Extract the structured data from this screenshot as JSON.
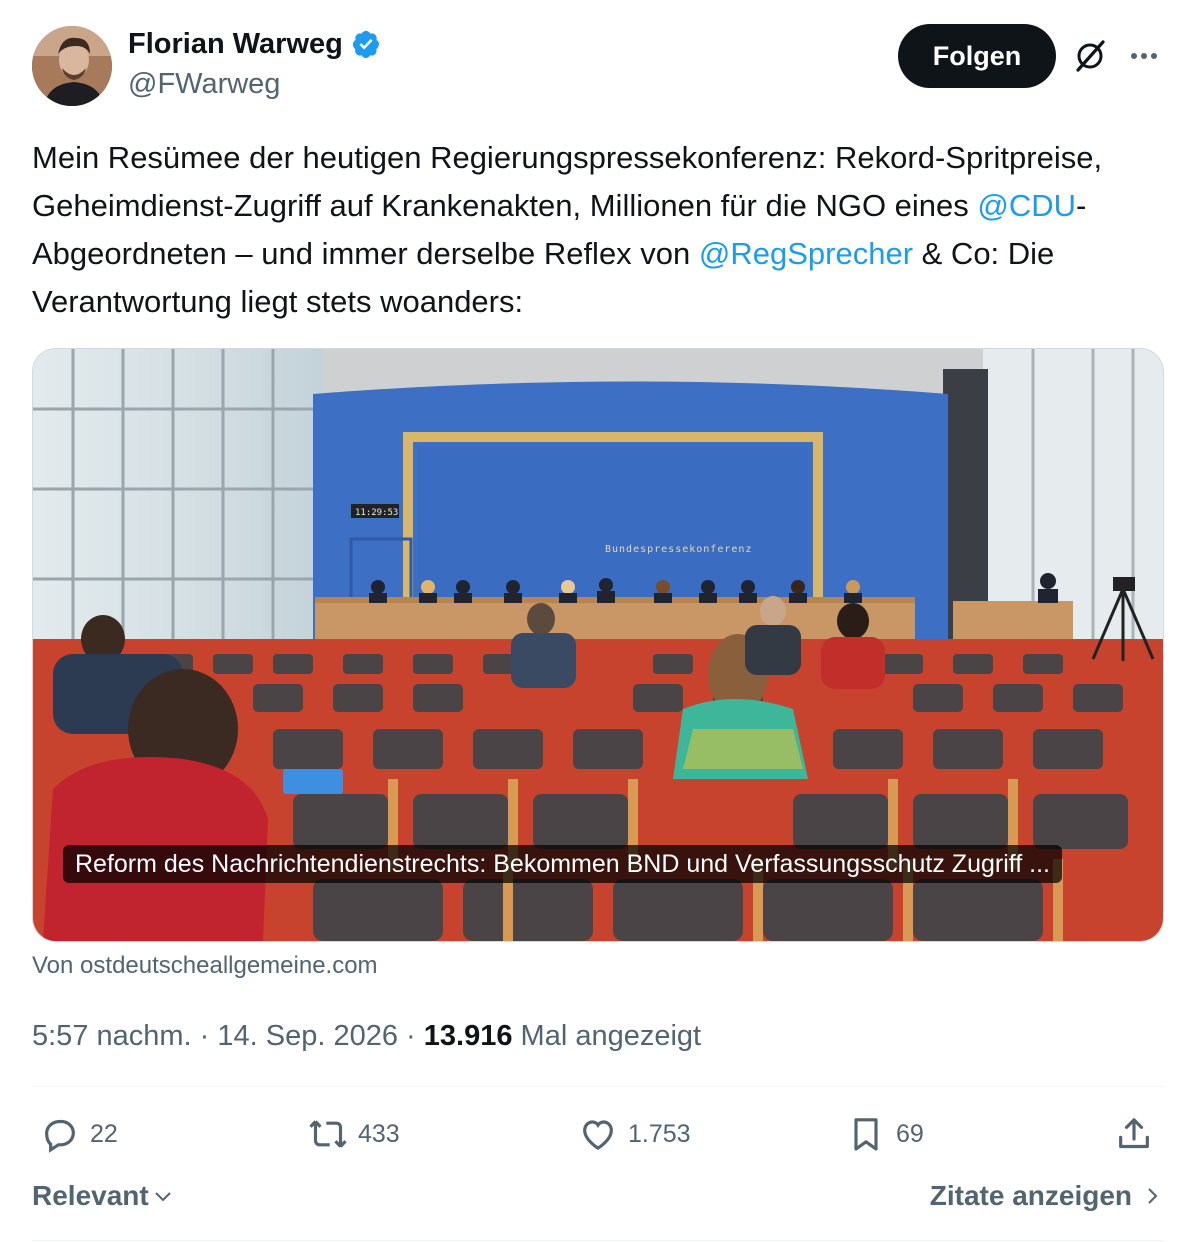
{
  "author": {
    "display_name": "Florian Warweg",
    "handle": "@FWarweg",
    "verified": true
  },
  "header": {
    "follow_label": "Folgen",
    "icons": [
      "grok-icon",
      "more-icon"
    ]
  },
  "tweet": {
    "text_part1": "Mein Resümee der heutigen Regierungspressekonferenz: Rekord-Spritpreise, Geheimdienst-Zugriff auf Krankenakten, Millionen für die NGO eines ",
    "mention1": "@CDU",
    "text_part2": "-Abgeordneten – und immer derselbe Reflex von ",
    "mention2": "@RegSprecher",
    "text_part3": " & Co:  Die Verantwortung liegt stets woanders:"
  },
  "card": {
    "image_sign_text": "Bundespressekonferenz",
    "clock_text": "11:29:53",
    "title": "Reform des Nachrichtendienstrechts: Bekommen BND und Verfassungsschutz Zugriff ...",
    "source": "Von ostdeutscheallgemeine.com"
  },
  "meta": {
    "time": "5:57 nachm.",
    "separator": " · ",
    "date": "14. Sep. 2026",
    "views_count": "13.916",
    "views_label": " Mal angezeigt"
  },
  "actions": {
    "replies": "22",
    "reposts": "433",
    "likes": "1.753",
    "bookmarks": "69"
  },
  "footer": {
    "sort_label": "Relevant",
    "quotes_label": "Zitate anzeigen"
  },
  "colors": {
    "accent": "#1d9bf0",
    "text": "#0f1419",
    "secondary": "#536471",
    "follow_bg": "#0f1419"
  }
}
